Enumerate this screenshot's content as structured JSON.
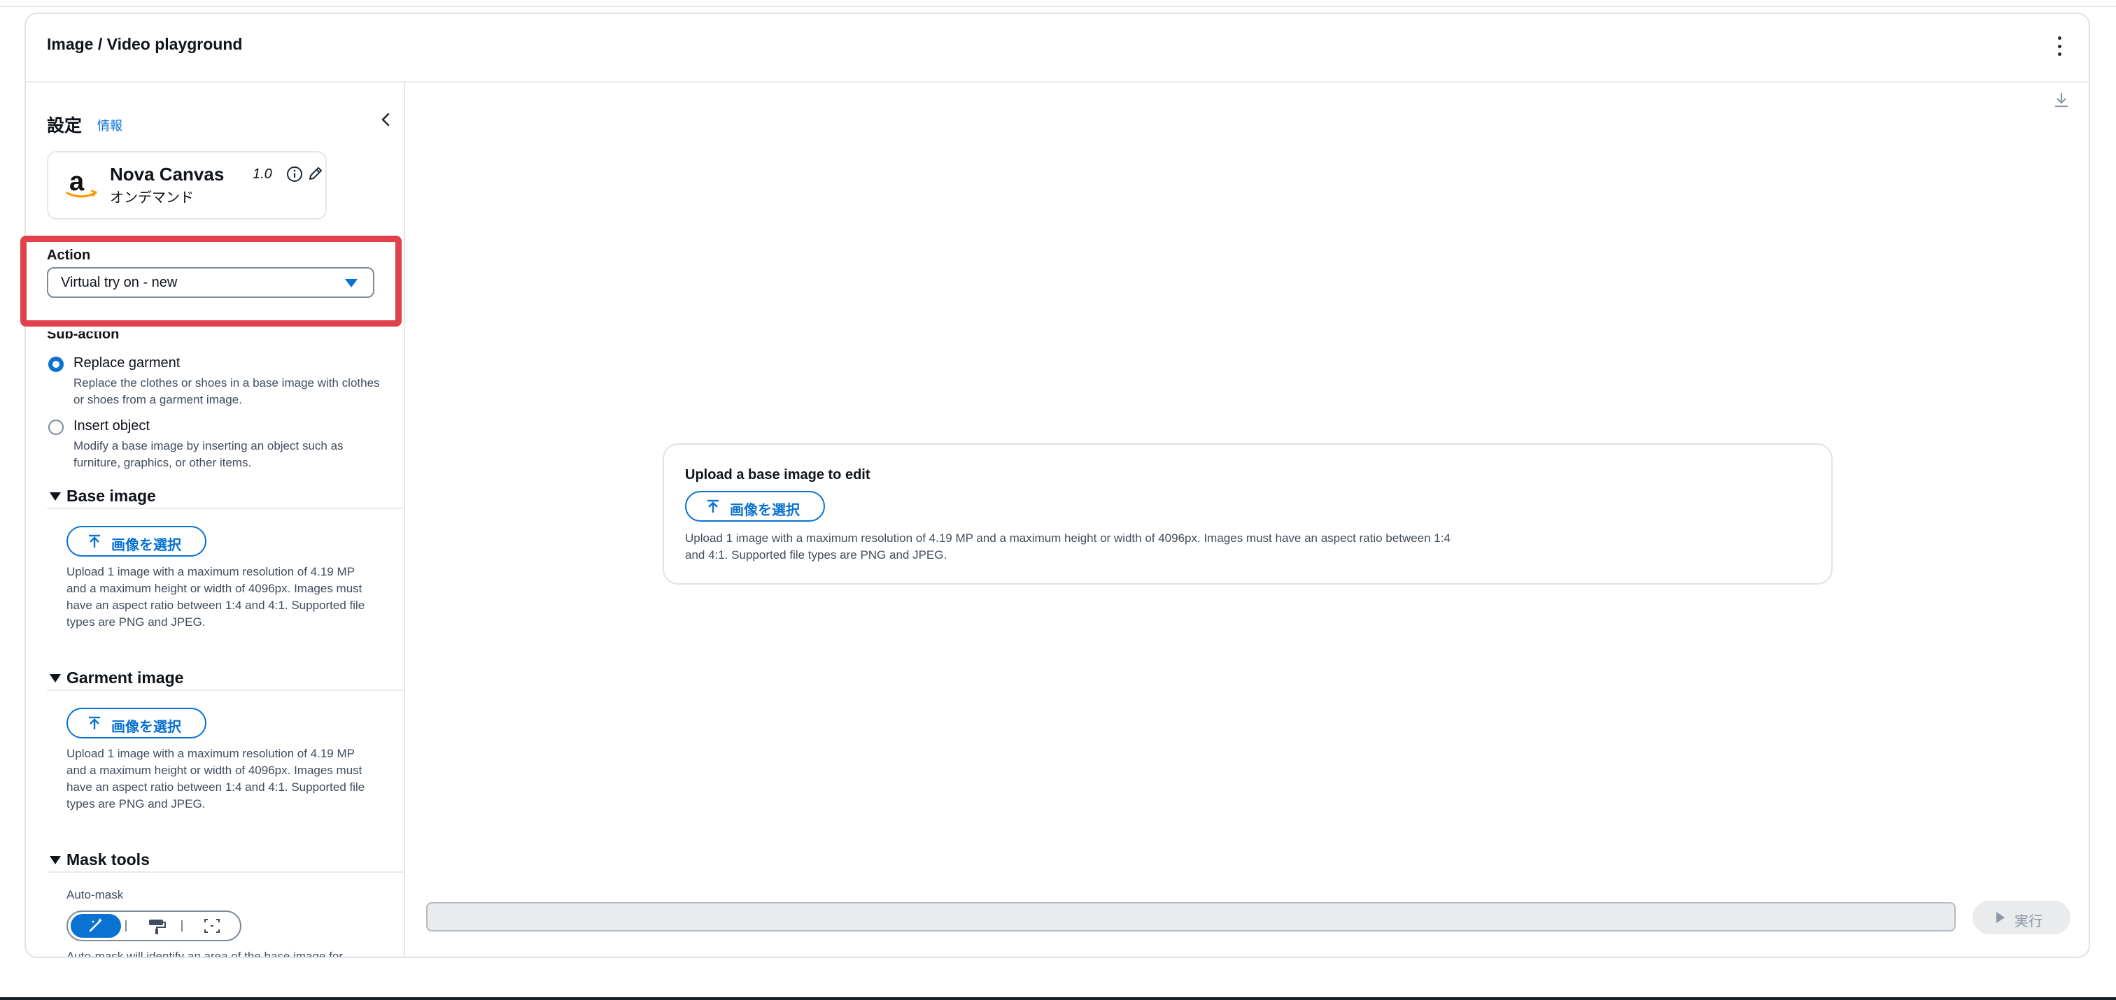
{
  "app": {
    "title": "Image / Video playground"
  },
  "sidebar": {
    "settings_title": "設定",
    "info_link": "情報",
    "model": {
      "name": "Nova Canvas",
      "version": "1.0",
      "mode": "オンデマンド"
    },
    "action": {
      "label": "Action",
      "value": "Virtual try on - new"
    },
    "subaction": {
      "label": "Sub-action",
      "options": [
        {
          "label": "Replace garment",
          "description": "Replace the clothes or shoes in a base image with clothes or shoes from a garment image.",
          "checked": true
        },
        {
          "label": "Insert object",
          "description": "Modify a base image by inserting an object such as furniture, graphics, or other items.",
          "checked": false
        }
      ]
    },
    "base_image": {
      "title": "Base image",
      "button": "画像を選択",
      "help": "Upload 1 image with a maximum resolution of 4.19 MP and a maximum height or width of 4096px. Images must have an aspect ratio between 1:4 and 4:1. Supported file types are PNG and JPEG."
    },
    "garment_image": {
      "title": "Garment image",
      "button": "画像を選択",
      "help": "Upload 1 image with a maximum resolution of 4.19 MP and a maximum height or width of 4096px. Images must have an aspect ratio between 1:4 and 4:1. Supported file types are PNG and JPEG."
    },
    "mask_tools": {
      "title": "Mask tools",
      "automask_label": "Auto-mask",
      "modes": [
        "magic-wand-icon",
        "paint-roller-icon",
        "select-box-icon"
      ],
      "selected_mode": "magic-wand-icon",
      "help": "Auto-mask will identify an area of the base image for"
    }
  },
  "main": {
    "upload_card": {
      "title": "Upload a base image to edit",
      "button": "画像を選択",
      "help": "Upload 1 image with a maximum resolution of 4.19 MP and a maximum height or width of 4096px. Images must have an aspect ratio between 1:4 and 4:1. Supported file types are PNG and JPEG."
    },
    "run_button": "実行"
  },
  "colors": {
    "accent": "#0972d3",
    "highlight": "#e0414a",
    "text": "#0f141a",
    "muted": "#414d5c"
  }
}
